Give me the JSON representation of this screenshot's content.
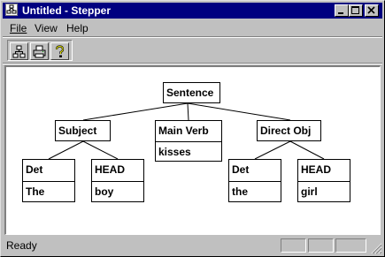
{
  "window": {
    "title": "Untitled - Stepper"
  },
  "menu": {
    "file": "File",
    "view": "View",
    "help": "Help"
  },
  "toolbar": {
    "icons": [
      "tree-icon",
      "printer-icon",
      "help-icon"
    ]
  },
  "tree": {
    "sentence": "Sentence",
    "subject": "Subject",
    "main_verb": "Main Verb",
    "main_verb_word": "kisses",
    "direct_obj": "Direct Obj",
    "subj_det": "Det",
    "subj_det_word": "The",
    "subj_head": "HEAD",
    "subj_head_word": "boy",
    "obj_det": "Det",
    "obj_det_word": "the",
    "obj_head": "HEAD",
    "obj_head_word": "girl"
  },
  "status": {
    "text": "Ready"
  },
  "colors": {
    "titlebar": "#000080",
    "face": "#c0c0c0",
    "canvas": "#ffffff"
  }
}
